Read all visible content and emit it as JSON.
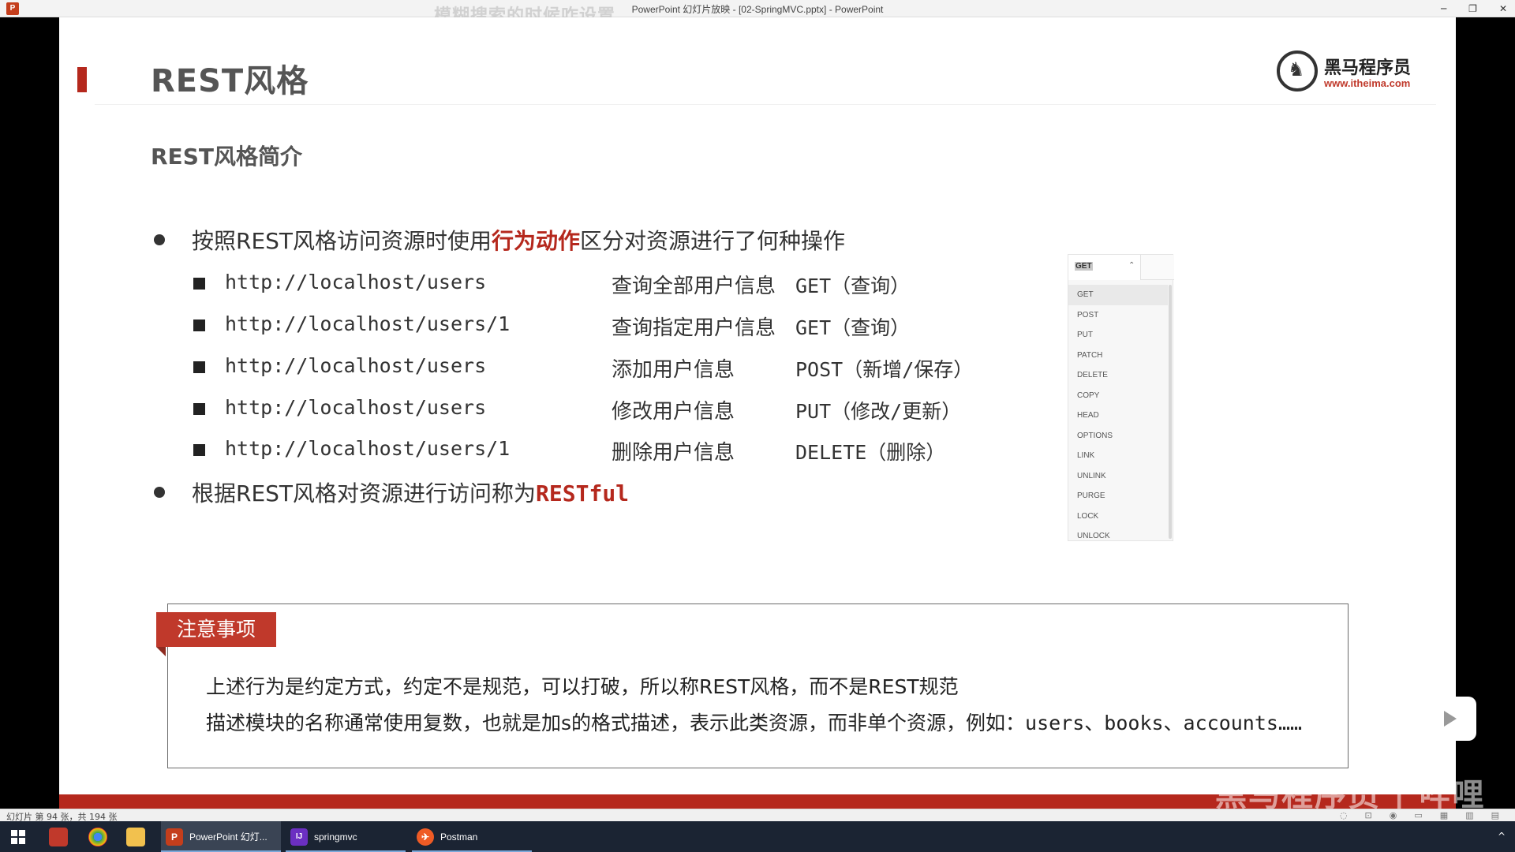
{
  "window": {
    "title": "PowerPoint 幻灯片放映 - [02-SpringMVC.pptx] - PowerPoint",
    "overlay_text": "模糊搜索的时候咋设置",
    "buttons": [
      "─",
      "❐",
      "✕"
    ]
  },
  "slide": {
    "title": "REST风格",
    "logo": {
      "name": "黑马程序员",
      "url": "www.itheima.com"
    },
    "subtitle": "REST风格简介",
    "bullet1": {
      "before": "按照REST风格访问资源时使用",
      "highlight": "行为动作",
      "after": "区分对资源进行了何种操作"
    },
    "rows": [
      {
        "url": "http://localhost/users",
        "desc": "查询全部用户信息",
        "method": "GET（查询）"
      },
      {
        "url": "http://localhost/users/1",
        "desc": "查询指定用户信息",
        "method": "GET（查询）"
      },
      {
        "url": "http://localhost/users",
        "desc": "添加用户信息",
        "method": "POST（新增/保存）"
      },
      {
        "url": "http://localhost/users",
        "desc": "修改用户信息",
        "method": "PUT（修改/更新）"
      },
      {
        "url": "http://localhost/users/1",
        "desc": "删除用户信息",
        "method": "DELETE（删除）"
      }
    ],
    "bullet2": {
      "before": "根据REST风格对资源进行访问称为",
      "highlight": "RESTful"
    },
    "dropdown": {
      "selected": "GET",
      "options": [
        "GET",
        "POST",
        "PUT",
        "PATCH",
        "DELETE",
        "COPY",
        "HEAD",
        "OPTIONS",
        "LINK",
        "UNLINK",
        "PURGE",
        "LOCK",
        "UNLOCK"
      ]
    },
    "note": {
      "tag": "注意事项",
      "line1": "上述行为是约定方式，约定不是规范，可以打破，所以称REST风格，而不是REST规范",
      "line2_before": "描述模块的名称通常使用复数，也就是加s的格式描述，表示此类资源，而非单个资源，例如：",
      "line2_mono": "users、books、accounts……"
    },
    "watermark": "黑马程序员 | 哔哩"
  },
  "statusbar": {
    "text": "幻灯片 第 94 张，共 194 张"
  },
  "taskbar": {
    "apps": [
      {
        "label": "PowerPoint 幻灯...",
        "color": "#c43e1c",
        "glyph": "P"
      },
      {
        "label": "springmvc",
        "color": "#6b2fc2",
        "glyph": "IJ"
      },
      {
        "label": "Postman",
        "color": "#ef5b25",
        "glyph": "✈"
      }
    ],
    "tray": "^"
  },
  "colors": {
    "accent": "#b5281d",
    "note_tag": "#c0392b",
    "taskbar": "#1b2433"
  }
}
